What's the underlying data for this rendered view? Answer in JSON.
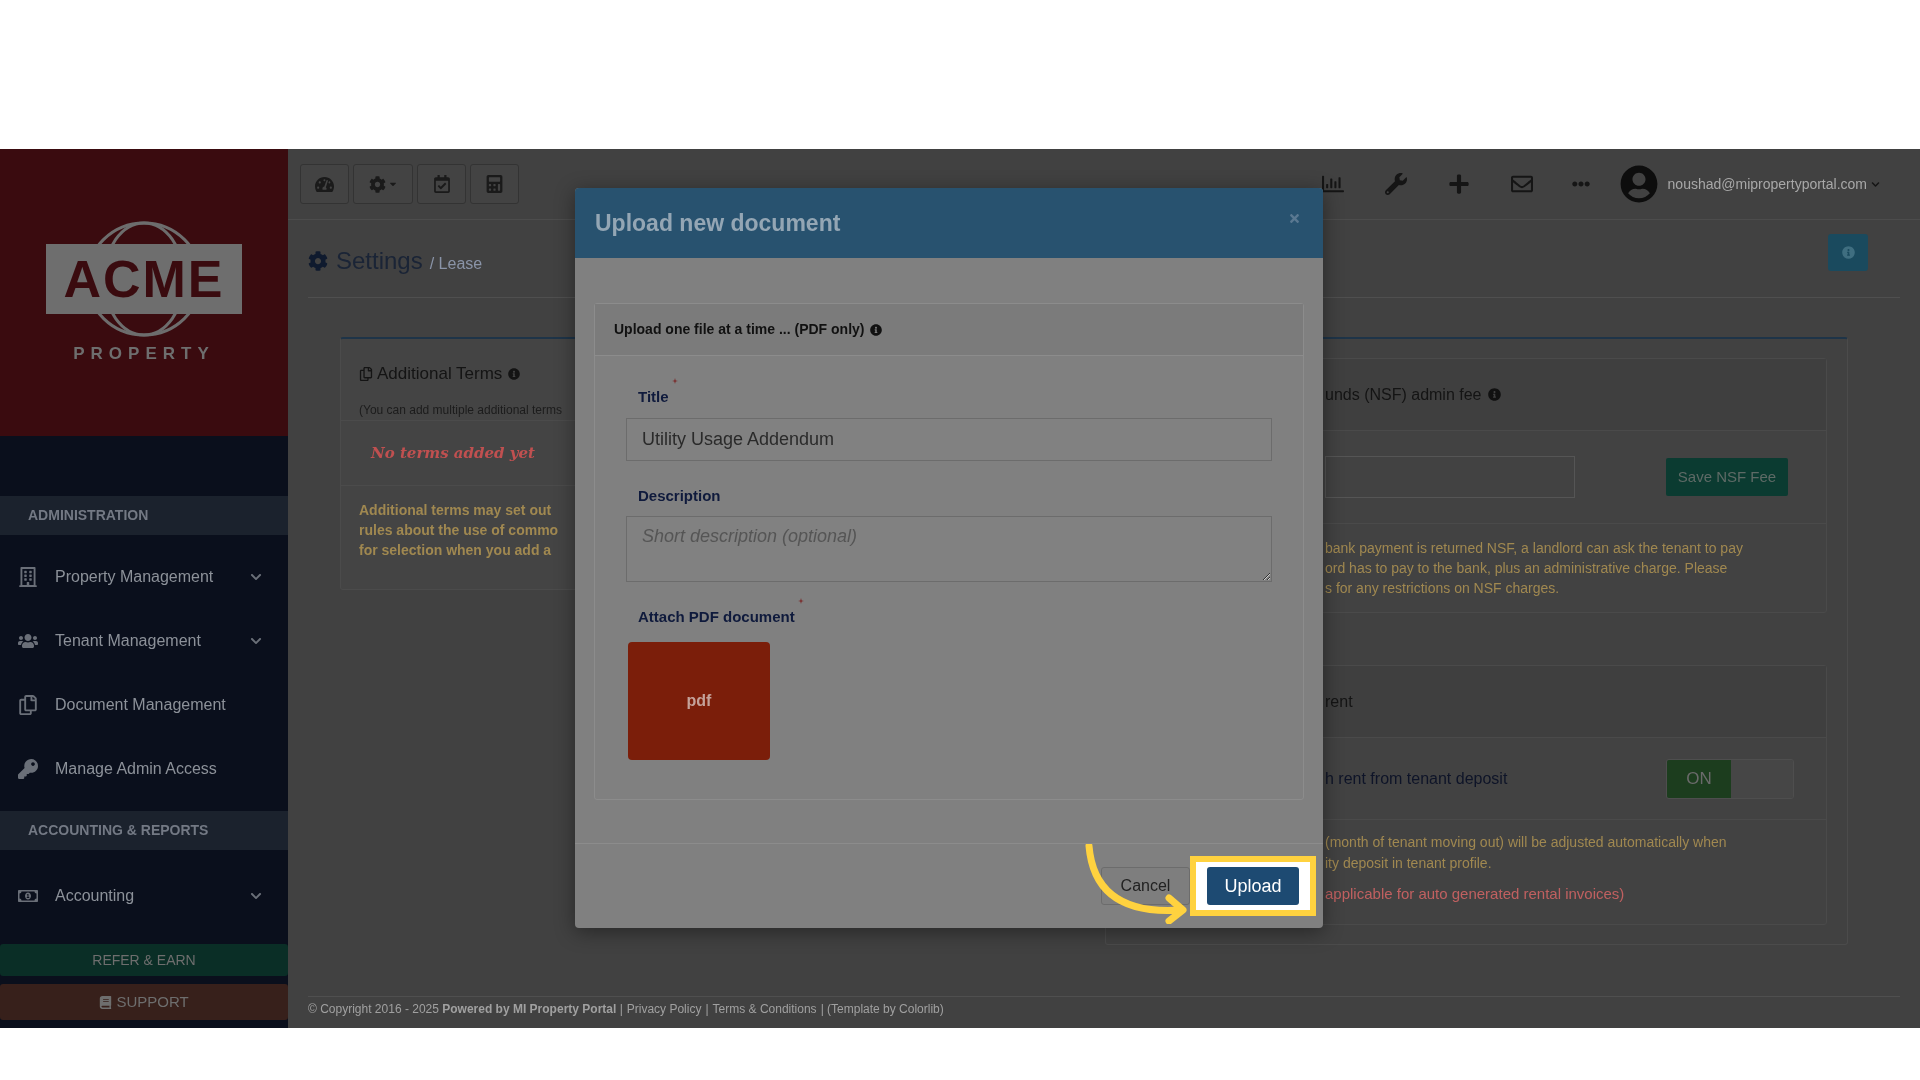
{
  "sidebar": {
    "logo": {
      "name": "ACME",
      "tagline": "PROPERTY"
    },
    "sections": [
      {
        "heading": "ADMINISTRATION",
        "items": [
          {
            "label": "Property Management",
            "expandable": true
          },
          {
            "label": "Tenant Management",
            "expandable": true
          },
          {
            "label": "Document Management",
            "expandable": false
          },
          {
            "label": "Manage Admin Access",
            "expandable": false
          }
        ]
      },
      {
        "heading": "ACCOUNTING & REPORTS",
        "items": [
          {
            "label": "Accounting",
            "expandable": true
          }
        ]
      }
    ],
    "buttons": [
      {
        "label": "REFER & EARN",
        "kind": "refer"
      },
      {
        "label": "SUPPORT",
        "kind": "support"
      }
    ]
  },
  "topbar": {
    "user_email": "noushad@mipropertyportal.com"
  },
  "page": {
    "title": "Settings",
    "breadcrumb": "/ Lease"
  },
  "left_card": {
    "title": "Additional Terms",
    "note": "(You can add multiple additional terms",
    "empty_message": "No terms added yet",
    "help_lines": [
      "Additional terms may set out",
      "rules about the use of commo",
      "for selection when you add a"
    ]
  },
  "right_card": {
    "sections": [
      {
        "kind": "fee",
        "title": "unds (NSF) admin fee",
        "button": "Save NSF Fee",
        "help_lines": [
          "bank payment is returned NSF, a landlord can ask the tenant to pay",
          "ord has to pay to the bank, plus an administrative charge. Please",
          "s for any restrictions on NSF charges."
        ]
      },
      {
        "kind": "toggle",
        "title": "rent",
        "row_label": "h rent from tenant deposit",
        "toggle": {
          "label": "ON",
          "on": true
        },
        "help_lines": [
          "(month of tenant moving out) will be adjusted automatically when",
          "ity deposit in tenant profile."
        ],
        "note": "applicable for auto generated rental invoices)"
      }
    ]
  },
  "modal": {
    "title": "Upload new document",
    "panel_header": "Upload one file at a time ... (PDF only)",
    "fields": [
      {
        "kind": "text",
        "label": "Title",
        "required": true,
        "value": "Utility Usage Addendum"
      },
      {
        "kind": "textarea",
        "label": "Description",
        "required": false,
        "placeholder": "Short description (optional)"
      },
      {
        "kind": "file",
        "label": "Attach PDF document",
        "required": true,
        "tile": "pdf"
      }
    ],
    "buttons": [
      {
        "label": "Cancel",
        "kind": "secondary",
        "highlighted": false
      },
      {
        "label": "Upload",
        "kind": "primary",
        "highlighted": true
      }
    ]
  },
  "footer": [
    {
      "kind": "text",
      "text": "© Copyright 2016 - 2025 **Powered by MI Property Portal** |"
    },
    {
      "kind": "link",
      "text": "Privacy Policy"
    },
    {
      "kind": "text",
      "text": "|"
    },
    {
      "kind": "link",
      "text": "Terms & Conditions"
    },
    {
      "kind": "text",
      "text": "| (Template by Colorlib)"
    }
  ]
}
